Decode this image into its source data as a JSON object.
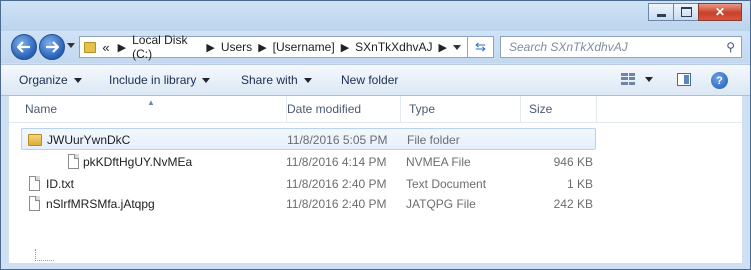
{
  "search": {
    "placeholder": "Search SXnTkXdhvAJ"
  },
  "breadcrumb": {
    "overflow": "«",
    "items": [
      "Local Disk (C:)",
      "Users",
      "[Username]",
      "SXnTkXdhvAJ"
    ]
  },
  "toolbar": {
    "organize": "Organize",
    "include_in_library": "Include in library",
    "share_with": "Share with",
    "new_folder": "New folder"
  },
  "columns": {
    "name": "Name",
    "date_modified": "Date modified",
    "type": "Type",
    "size": "Size"
  },
  "files": [
    {
      "name": "JWUurYwnDkC",
      "date": "11/8/2016 5:05 PM",
      "type": "File folder",
      "size": "",
      "icon": "folder-icon"
    },
    {
      "name": "pkKDftHgUY.NvMEa",
      "date": "11/8/2016 4:14 PM",
      "type": "NVMEA File",
      "size": "946 KB",
      "icon": "file-icon"
    },
    {
      "name": "ID.txt",
      "date": "11/8/2016 2:40 PM",
      "type": "Text Document",
      "size": "1 KB",
      "icon": "text-file-icon"
    },
    {
      "name": "nSlrfMRSMfa.jAtqpg",
      "date": "11/8/2016 2:40 PM",
      "type": "JATQPG File",
      "size": "242 KB",
      "icon": "file-icon"
    }
  ]
}
